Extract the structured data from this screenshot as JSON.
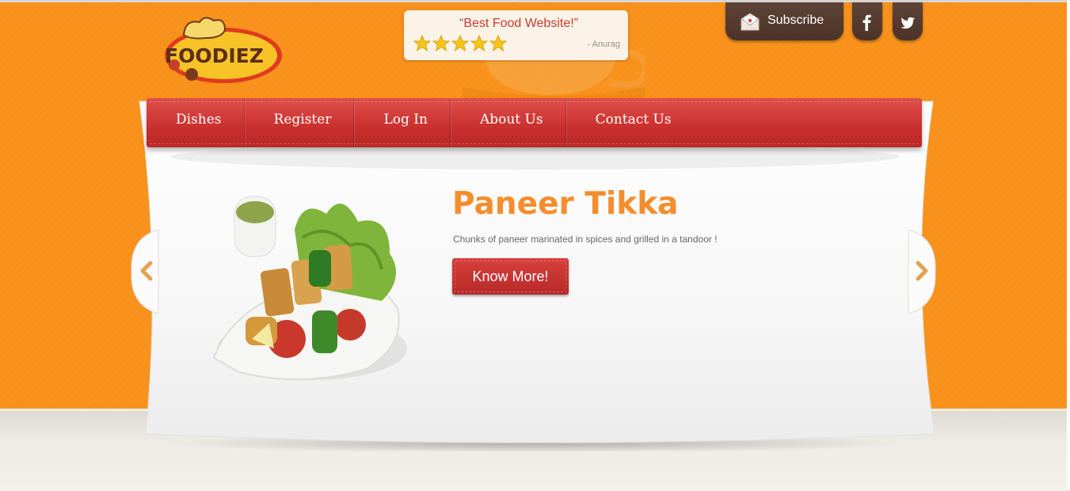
{
  "brand": {
    "logo_text": "FOODIEZ"
  },
  "testimonial": {
    "quote": "“Best Food Website!”",
    "rating": 5,
    "rating_max": 5,
    "author": "- Anurag"
  },
  "header_actions": {
    "subscribe_label": "Subscribe",
    "social": [
      {
        "icon": "facebook-icon"
      },
      {
        "icon": "twitter-icon"
      }
    ]
  },
  "nav": {
    "items": [
      {
        "label": "Dishes"
      },
      {
        "label": "Register"
      },
      {
        "label": "Log In"
      },
      {
        "label": "About Us"
      },
      {
        "label": "Contact Us"
      }
    ]
  },
  "slide": {
    "title": "Paneer Tikka",
    "description": "Chunks of paneer marinated in spices and grilled in a tandoor !",
    "cta_label": "Know More!",
    "prev_icon": "chevron-left-icon",
    "next_icon": "chevron-right-icon"
  },
  "colors": {
    "orange_bg": "#f9931e",
    "nav_red": "#c9302e",
    "title_orange": "#f58d2e",
    "dark_brown": "#4c3329"
  }
}
